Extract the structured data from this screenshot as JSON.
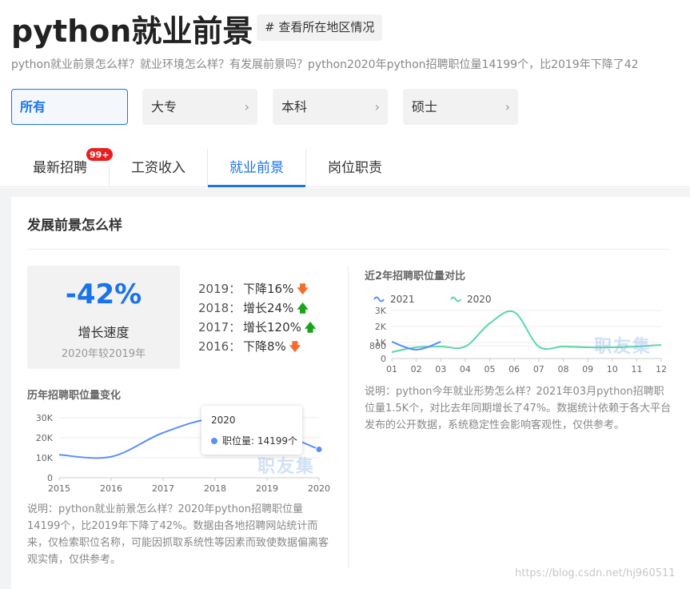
{
  "header": {
    "title": "python就业前景",
    "area_tag": "# 查看所在地区情况",
    "subtitle": "python就业前景怎么样？就业环境怎么样？有发展前景吗？python2020年python招聘职位量14199个，比2019年下降了42"
  },
  "edu_filters": [
    {
      "label": "所有",
      "active": true
    },
    {
      "label": "大专",
      "active": false
    },
    {
      "label": "本科",
      "active": false
    },
    {
      "label": "硕士",
      "active": false
    }
  ],
  "tabs": [
    {
      "label": "最新招聘",
      "active": false
    },
    {
      "label": "工资收入",
      "active": false
    },
    {
      "label": "就业前景",
      "active": true
    },
    {
      "label": "岗位职责",
      "active": false
    }
  ],
  "badge": "99+",
  "section": {
    "title": "发展前景怎么样",
    "growth": {
      "value": "-42%",
      "label": "增长速度",
      "sub": "2020年较2019年"
    },
    "year_changes": [
      {
        "year": "2019：",
        "change": "下降16%",
        "direction": "down"
      },
      {
        "year": "2018：",
        "change": "增长24%",
        "direction": "up"
      },
      {
        "year": "2017：",
        "change": "增长120%",
        "direction": "up"
      },
      {
        "year": "2016：",
        "change": "下降8%",
        "direction": "down"
      }
    ],
    "left_chart_title": "历年招聘职位量变化",
    "right_chart_title": "近2年招聘职位量对比",
    "left_note": "说明：python就业前景怎么样？2020年python招聘职位量14199个，比2019年下降了42%。数据由各地招聘网站统计而来，仅检索职位名称，可能因抓取系统性等因素而致使数据偏离客观实情，仅供参考。",
    "right_note": "说明：python今年就业形势怎么样？2021年03月python招聘职位量1.5K个，对比去年同期增长了47%。数据统计依赖于各大平台发布的公开数据，系统稳定性会影响客观性，仅供参考。",
    "tooltip": {
      "title": "2020",
      "row": "职位量: 14199个"
    },
    "watermark": "职友集",
    "csdn_watermark": "https://blog.csdn.net/hj960511"
  },
  "chart_data": [
    {
      "type": "line",
      "title": "历年招聘职位量变化",
      "x": [
        "2015",
        "2016",
        "2017",
        "2018",
        "2019",
        "2020"
      ],
      "series": [
        {
          "name": "职位量",
          "values": [
            11500,
            10500,
            22500,
            29500,
            24500,
            14199
          ]
        }
      ],
      "yticks": [
        "0",
        "10K",
        "20K",
        "30K"
      ],
      "ylim": [
        0,
        30000
      ],
      "grid": true,
      "color": "#5b8ff9"
    },
    {
      "type": "line",
      "title": "近2年招聘职位量对比",
      "x": [
        "01",
        "02",
        "03",
        "04",
        "05",
        "06",
        "07",
        "08",
        "09",
        "10",
        "11",
        "12"
      ],
      "series": [
        {
          "name": "2021",
          "values": [
            1050,
            550,
            1050
          ],
          "color": "#5b8ff9"
        },
        {
          "name": "2020",
          "values": [
            400,
            700,
            750,
            750,
            2200,
            2900,
            750,
            750,
            700,
            700,
            750,
            850
          ],
          "color": "#5ad8a6"
        }
      ],
      "yticks": [
        "0",
        "800",
        "1K",
        "2K",
        "3K"
      ],
      "ylim": [
        0,
        3000
      ],
      "grid": true,
      "legend": "top-left"
    }
  ]
}
